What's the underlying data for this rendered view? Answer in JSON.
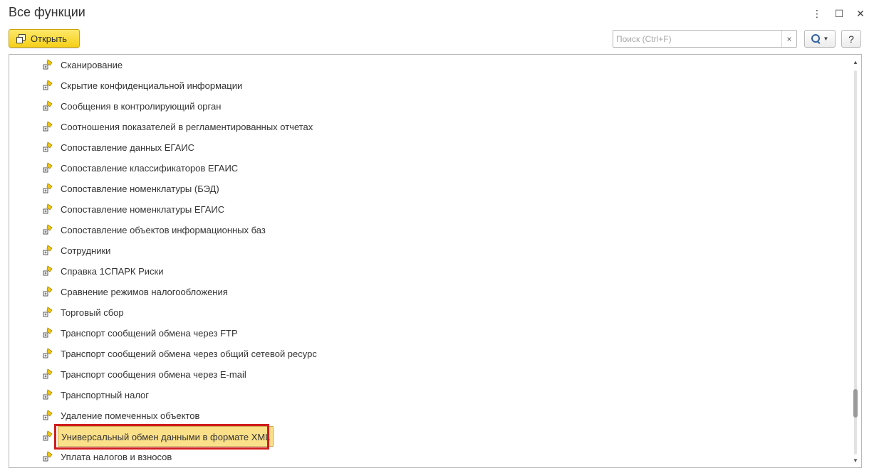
{
  "window": {
    "title": "Все функции",
    "more_icon": "⋮",
    "maximize_icon": "☐",
    "close_icon": "✕"
  },
  "toolbar": {
    "open_label": "Открыть",
    "search_placeholder": "Поиск (Ctrl+F)",
    "search_value": "",
    "clear_icon": "×",
    "help_label": "?"
  },
  "list": {
    "items": [
      "Сканирование",
      "Скрытие конфиденциальной информации",
      "Сообщения в контролирующий орган",
      "Соотношения показателей в регламентированных отчетах",
      "Сопоставление данных ЕГАИС",
      "Сопоставление классификаторов ЕГАИС",
      "Сопоставление номенклатуры (БЭД)",
      "Сопоставление номенклатуры ЕГАИС",
      "Сопоставление объектов информационных баз",
      "Сотрудники",
      "Справка 1СПАРК Риски",
      "Сравнение режимов налогообложения",
      "Торговый сбор",
      "Транспорт сообщений обмена через FTP",
      "Транспорт сообщений обмена через общий сетевой ресурс",
      "Транспорт сообщения обмена через E-mail",
      "Транспортный налог",
      "Удаление помеченных объектов",
      "Универсальный обмен данными в формате XML",
      "Уплата налогов и взносов"
    ],
    "selected_index": 18
  },
  "colors": {
    "accent": "#f5cf19",
    "selection": "#fbe08a",
    "highlight_frame": "#d01c1c"
  },
  "icons": {
    "row_icon": "processing-key-icon"
  }
}
